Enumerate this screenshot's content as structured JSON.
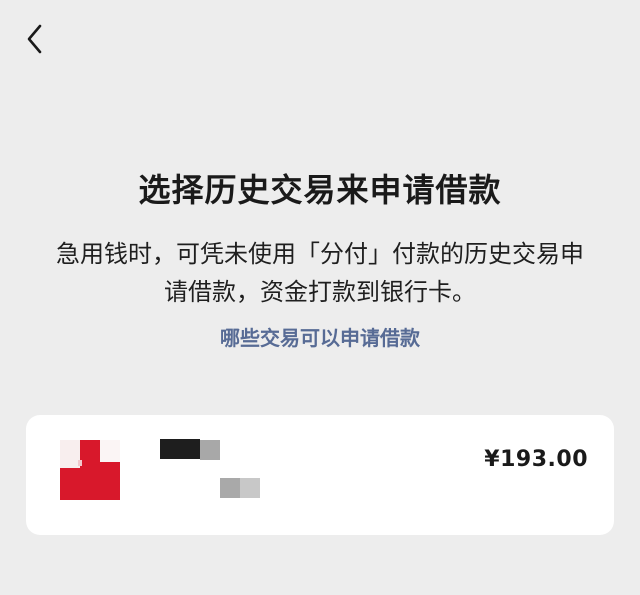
{
  "nav": {
    "back_icon": "chevron-left-icon"
  },
  "title": "选择历史交易来申请借款",
  "description": "急用钱时，可凭未使用「分付」付款的历史交易申请借款，资金打款到银行卡。",
  "help_link": "哪些交易可以申请借款",
  "transactions": [
    {
      "merchant_name": "",
      "merchant_detail": "",
      "amount": "¥193.00",
      "thumbnail_icon": "merchant-logo-pixelated",
      "thumbnail_colors": [
        "#d8182b",
        "#f8eeee"
      ]
    }
  ],
  "colors": {
    "background": "#ededed",
    "link": "#576b95",
    "card": "#ffffff"
  }
}
